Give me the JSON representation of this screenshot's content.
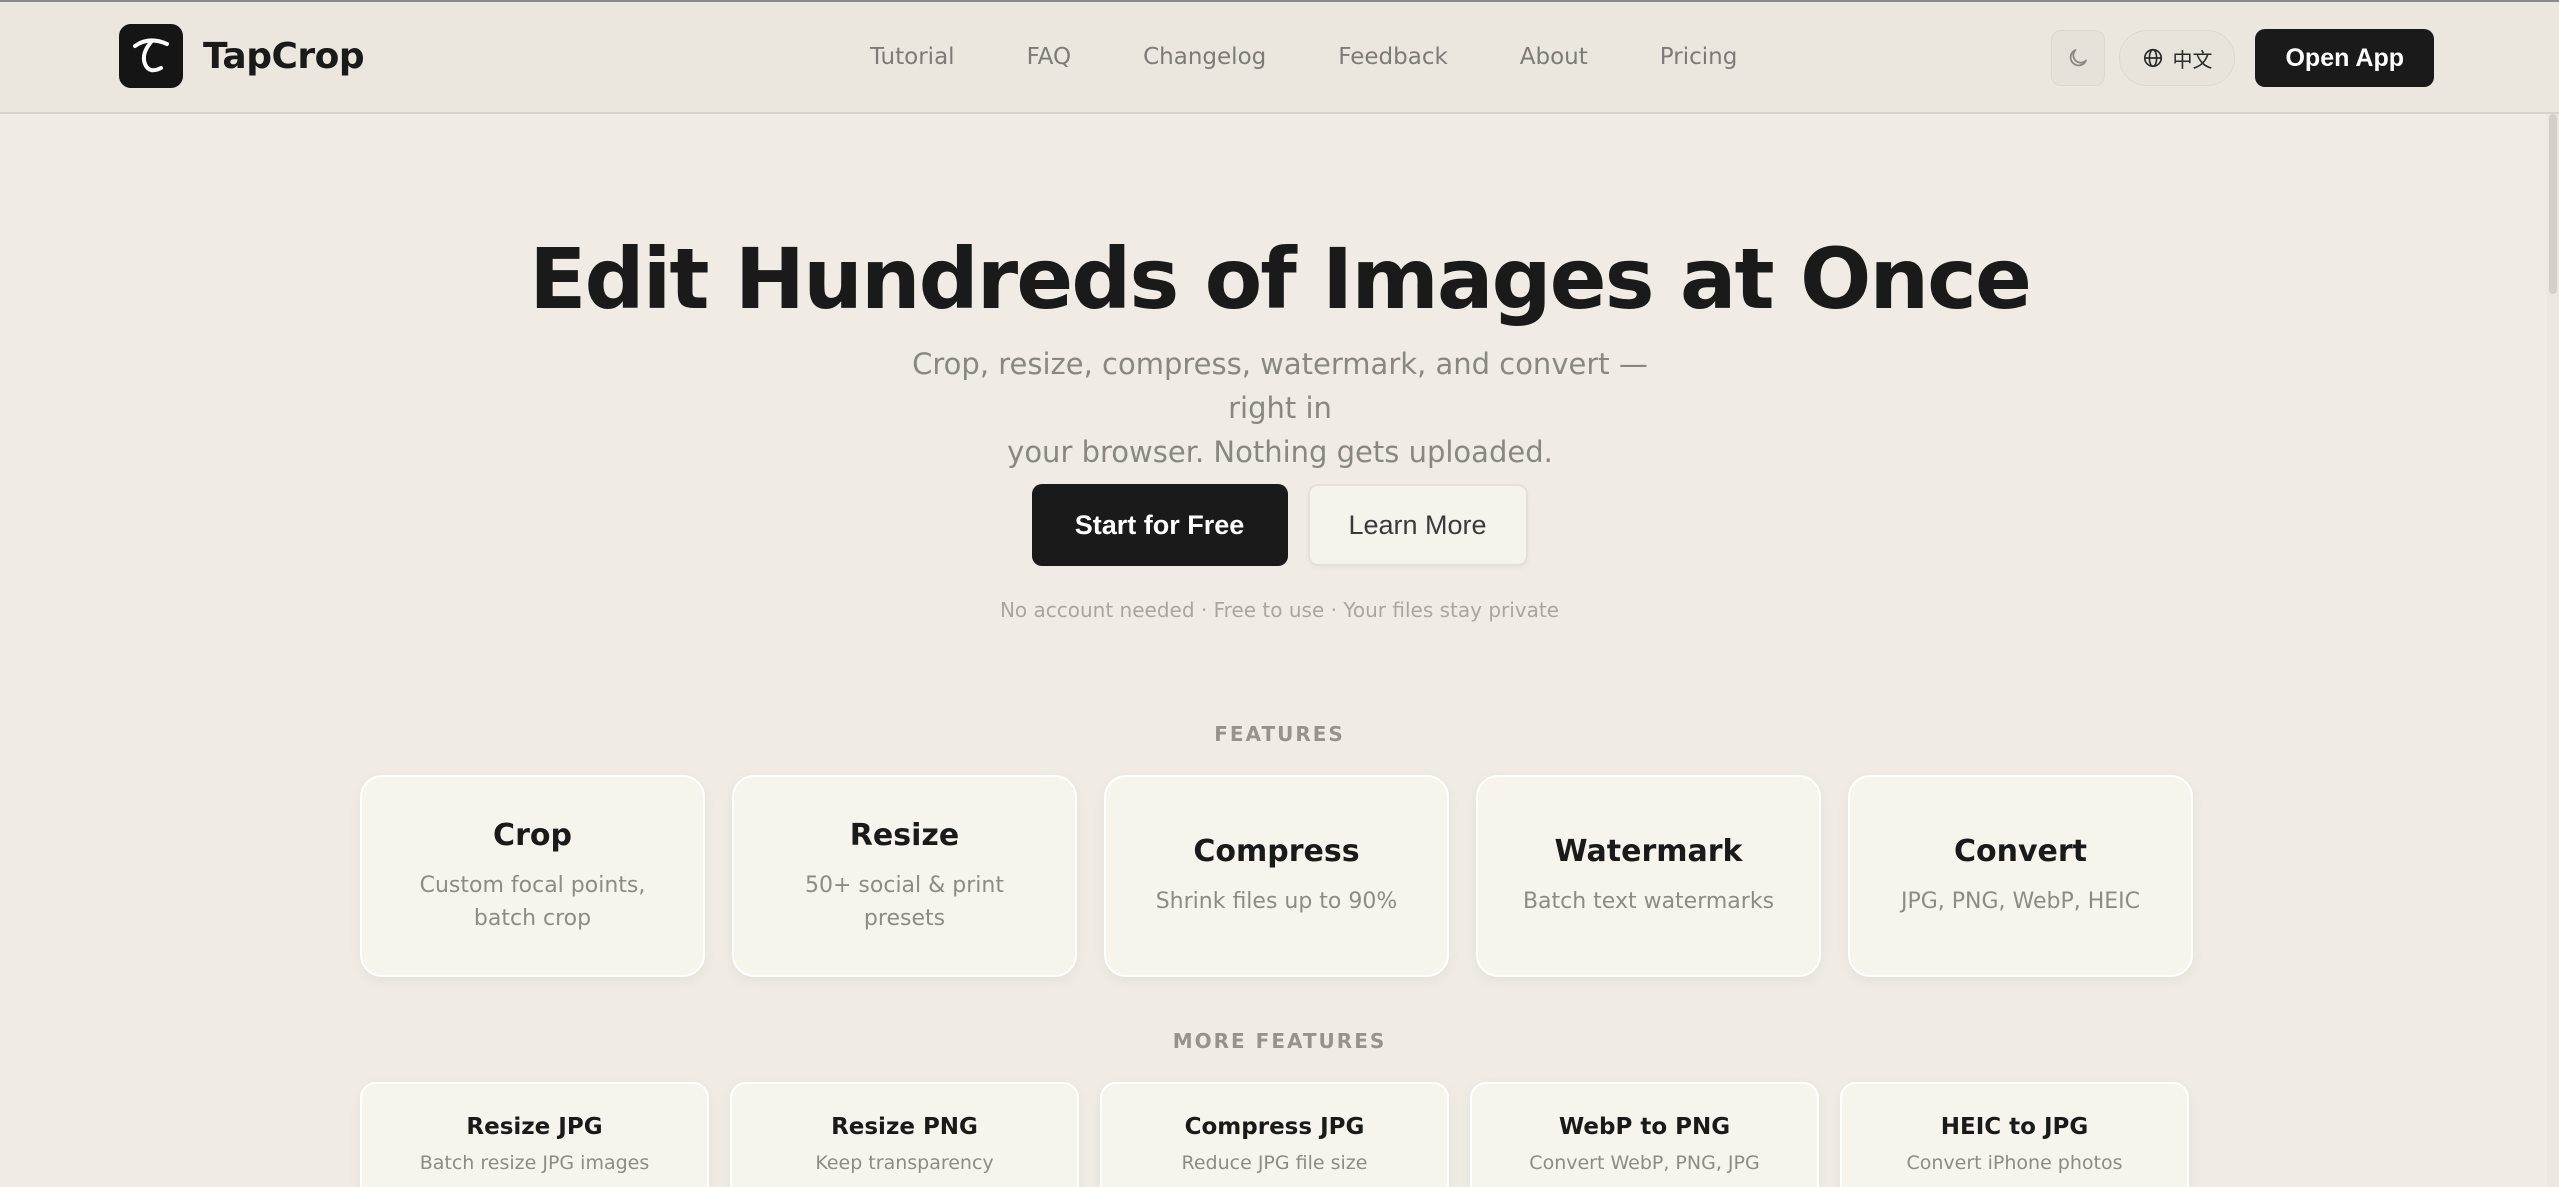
{
  "brand": {
    "name": "TapCrop",
    "logo_icon": "tapcrop-logo"
  },
  "nav": {
    "items": [
      {
        "label": "Tutorial"
      },
      {
        "label": "FAQ"
      },
      {
        "label": "Changelog"
      },
      {
        "label": "Feedback"
      },
      {
        "label": "About"
      },
      {
        "label": "Pricing"
      }
    ]
  },
  "header_actions": {
    "theme_icon": "moon-icon",
    "language_icon": "globe-icon",
    "language_label": "中文",
    "open_app_label": "Open App"
  },
  "hero": {
    "title": "Edit Hundreds of Images at Once",
    "subtitle_line1": "Crop, resize, compress, watermark, and convert — right in",
    "subtitle_line2": "your browser. Nothing gets uploaded.",
    "primary_cta": "Start for Free",
    "secondary_cta": "Learn More",
    "assurance": "No account needed · Free to use · Your files stay private"
  },
  "features": {
    "label": "FEATURES",
    "items": [
      {
        "title": "Crop",
        "desc": "Custom focal points, batch crop"
      },
      {
        "title": "Resize",
        "desc": "50+ social & print presets"
      },
      {
        "title": "Compress",
        "desc": "Shrink files up to 90%"
      },
      {
        "title": "Watermark",
        "desc": "Batch text watermarks"
      },
      {
        "title": "Convert",
        "desc": "JPG, PNG, WebP, HEIC"
      }
    ]
  },
  "more_features": {
    "label": "MORE FEATURES",
    "items": [
      {
        "title": "Resize JPG",
        "desc": "Batch resize JPG images"
      },
      {
        "title": "Resize PNG",
        "desc": "Keep transparency"
      },
      {
        "title": "Compress JPG",
        "desc": "Reduce JPG file size"
      },
      {
        "title": "WebP to PNG",
        "desc": "Convert WebP, PNG, JPG"
      },
      {
        "title": "HEIC to JPG",
        "desc": "Convert iPhone photos"
      }
    ]
  },
  "colors": {
    "background": "#f0ece5",
    "header": "#ebe7df",
    "primary": "#1a1a1a",
    "muted_text": "#8a8781",
    "card": "#f6f4ed"
  }
}
